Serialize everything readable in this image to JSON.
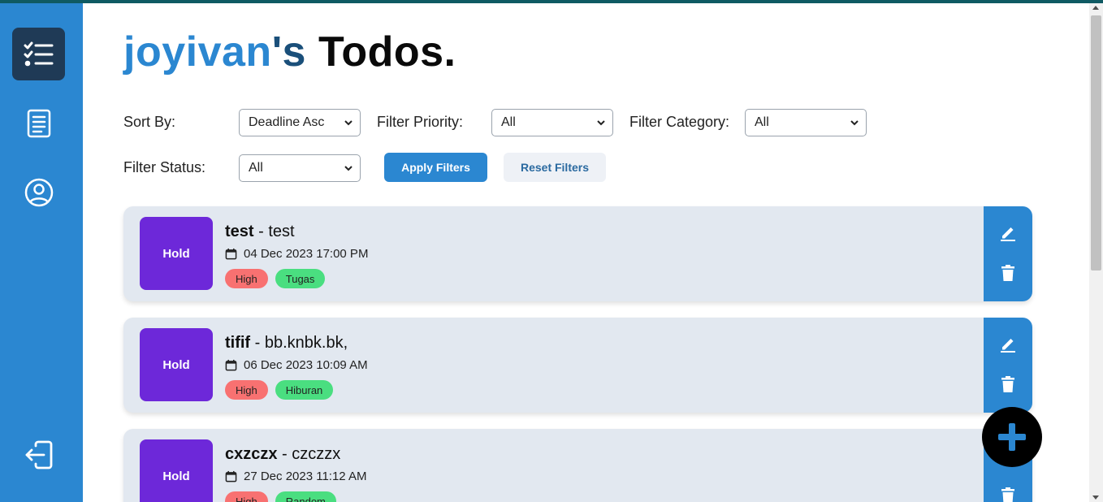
{
  "header": {
    "username": "joyivan",
    "apostrophe": "'s",
    "title_suffix": "Todos."
  },
  "sidebar": {
    "items": [
      {
        "name": "todos",
        "icon": "checklist-icon",
        "active": true
      },
      {
        "name": "notes",
        "icon": "document-icon",
        "active": false
      },
      {
        "name": "profile",
        "icon": "user-circle-icon",
        "active": false
      },
      {
        "name": "logout",
        "icon": "logout-icon",
        "active": false
      }
    ]
  },
  "filters": {
    "sort_by_label": "Sort By:",
    "sort_by_value": "Deadline Asc",
    "priority_label": "Filter Priority:",
    "priority_value": "All",
    "category_label": "Filter Category:",
    "category_value": "All",
    "status_label": "Filter Status:",
    "status_value": "All",
    "apply_label": "Apply Filters",
    "reset_label": "Reset Filters"
  },
  "todos": [
    {
      "status": "Hold",
      "title": "test",
      "separator": " - ",
      "description": "test",
      "deadline": "04 Dec 2023 17:00 PM",
      "priority": "High",
      "category": "Tugas"
    },
    {
      "status": "Hold",
      "title": "tifif",
      "separator": " - ",
      "description": "bb.knbk.bk,",
      "deadline": "06 Dec 2023 10:09 AM",
      "priority": "High",
      "category": "Hiburan"
    },
    {
      "status": "Hold",
      "title": "cxzczx",
      "separator": " - ",
      "description": "czczzx",
      "deadline": "27 Dec 2023 11:12 AM",
      "priority": "High",
      "category": "Random"
    }
  ],
  "colors": {
    "sidebar": "#2b87d1",
    "sidebar_active": "#1f3a56",
    "status_hold": "#6d28d9",
    "priority_high": "#f87171",
    "category_tag": "#4ade80",
    "card_bg": "#e2e8f0",
    "fab": "#000000"
  },
  "fab": {
    "icon": "plus-icon"
  }
}
